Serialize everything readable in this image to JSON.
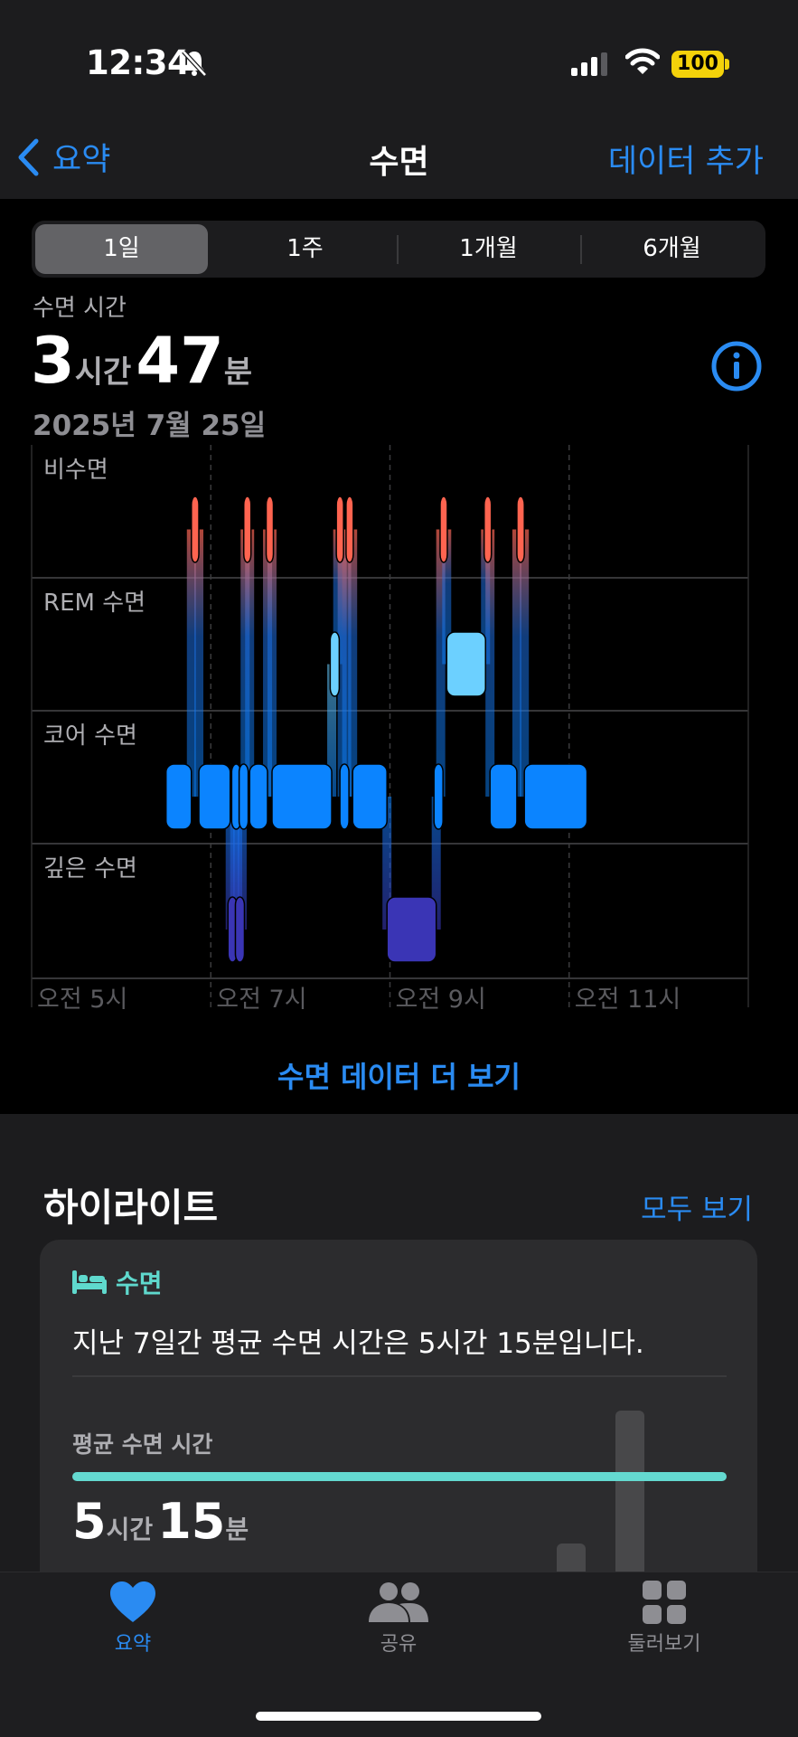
{
  "status": {
    "time": "12:34",
    "battery": "100"
  },
  "nav": {
    "back_label": "요약",
    "title": "수면",
    "add_label": "데이터 추가"
  },
  "segments": [
    {
      "label": "1일",
      "selected": true
    },
    {
      "label": "1주",
      "selected": false
    },
    {
      "label": "1개월",
      "selected": false
    },
    {
      "label": "6개월",
      "selected": false
    }
  ],
  "summary": {
    "label": "수면 시간",
    "hours": "3",
    "hours_unit": "시간",
    "minutes": "47",
    "minutes_unit": "분",
    "date": "2025년 7월 25일"
  },
  "chart_data": {
    "type": "sleep-stage-timeline",
    "stages": [
      "비수면",
      "REM 수면",
      "코어 수면",
      "깊은 수면"
    ],
    "x_ticks": [
      "오전 5시",
      "오전 7시",
      "오전 9시",
      "오전 11시"
    ],
    "x_range": [
      "05:00",
      "13:00"
    ],
    "colors": {
      "awake": "#ff6450",
      "rem": "#6cd0ff",
      "core": "#0b84ff",
      "deep": "#3a35b5"
    },
    "segments": [
      {
        "stage": "코어 수면",
        "start": "06:30",
        "end": "06:47"
      },
      {
        "stage": "비수면",
        "start": "06:47",
        "end": "06:52"
      },
      {
        "stage": "코어 수면",
        "start": "06:52",
        "end": "07:13"
      },
      {
        "stage": "깊은 수면",
        "start": "07:13",
        "end": "07:16"
      },
      {
        "stage": "코어 수면",
        "start": "07:16",
        "end": "07:18"
      },
      {
        "stage": "깊은 수면",
        "start": "07:18",
        "end": "07:21"
      },
      {
        "stage": "코어 수면",
        "start": "07:21",
        "end": "07:23"
      },
      {
        "stage": "비수면",
        "start": "07:23",
        "end": "07:26"
      },
      {
        "stage": "코어 수면",
        "start": "07:26",
        "end": "07:38"
      },
      {
        "stage": "비수면",
        "start": "07:38",
        "end": "07:41"
      },
      {
        "stage": "코어 수면",
        "start": "07:41",
        "end": "08:21"
      },
      {
        "stage": "REM 수면",
        "start": "08:21",
        "end": "08:25"
      },
      {
        "stage": "비수면",
        "start": "08:25",
        "end": "08:28"
      },
      {
        "stage": "코어 수면",
        "start": "08:28",
        "end": "08:31"
      },
      {
        "stage": "비수면",
        "start": "08:31",
        "end": "08:35"
      },
      {
        "stage": "코어 수면",
        "start": "08:35",
        "end": "08:58"
      },
      {
        "stage": "깊은 수면",
        "start": "08:58",
        "end": "09:31"
      },
      {
        "stage": "코어 수면",
        "start": "09:31",
        "end": "09:34"
      },
      {
        "stage": "비수면",
        "start": "09:34",
        "end": "09:38"
      },
      {
        "stage": "REM 수면",
        "start": "09:38",
        "end": "10:04"
      },
      {
        "stage": "비수면",
        "start": "10:04",
        "end": "10:07"
      },
      {
        "stage": "코어 수면",
        "start": "10:07",
        "end": "10:25"
      },
      {
        "stage": "비수면",
        "start": "10:25",
        "end": "10:30"
      },
      {
        "stage": "코어 수면",
        "start": "10:30",
        "end": "11:12"
      }
    ]
  },
  "more_link": "수면 데이터 더 보기",
  "highlights": {
    "title": "하이라이트",
    "see_all": "모두 보기",
    "card": {
      "category": "수면",
      "icon": "bed-icon",
      "text": "지난 7일간 평균 수면 시간은 5시간 15분입니다.",
      "avg_label": "평균 수면 시간",
      "avg_hours": "5",
      "avg_hours_unit": "시간",
      "avg_minutes": "15",
      "avg_minutes_unit": "분"
    }
  },
  "tabs": [
    {
      "label": "요약",
      "icon": "heart-icon",
      "active": true
    },
    {
      "label": "공유",
      "icon": "people-icon",
      "active": false
    },
    {
      "label": "둘러보기",
      "icon": "grid-icon",
      "active": false
    }
  ]
}
